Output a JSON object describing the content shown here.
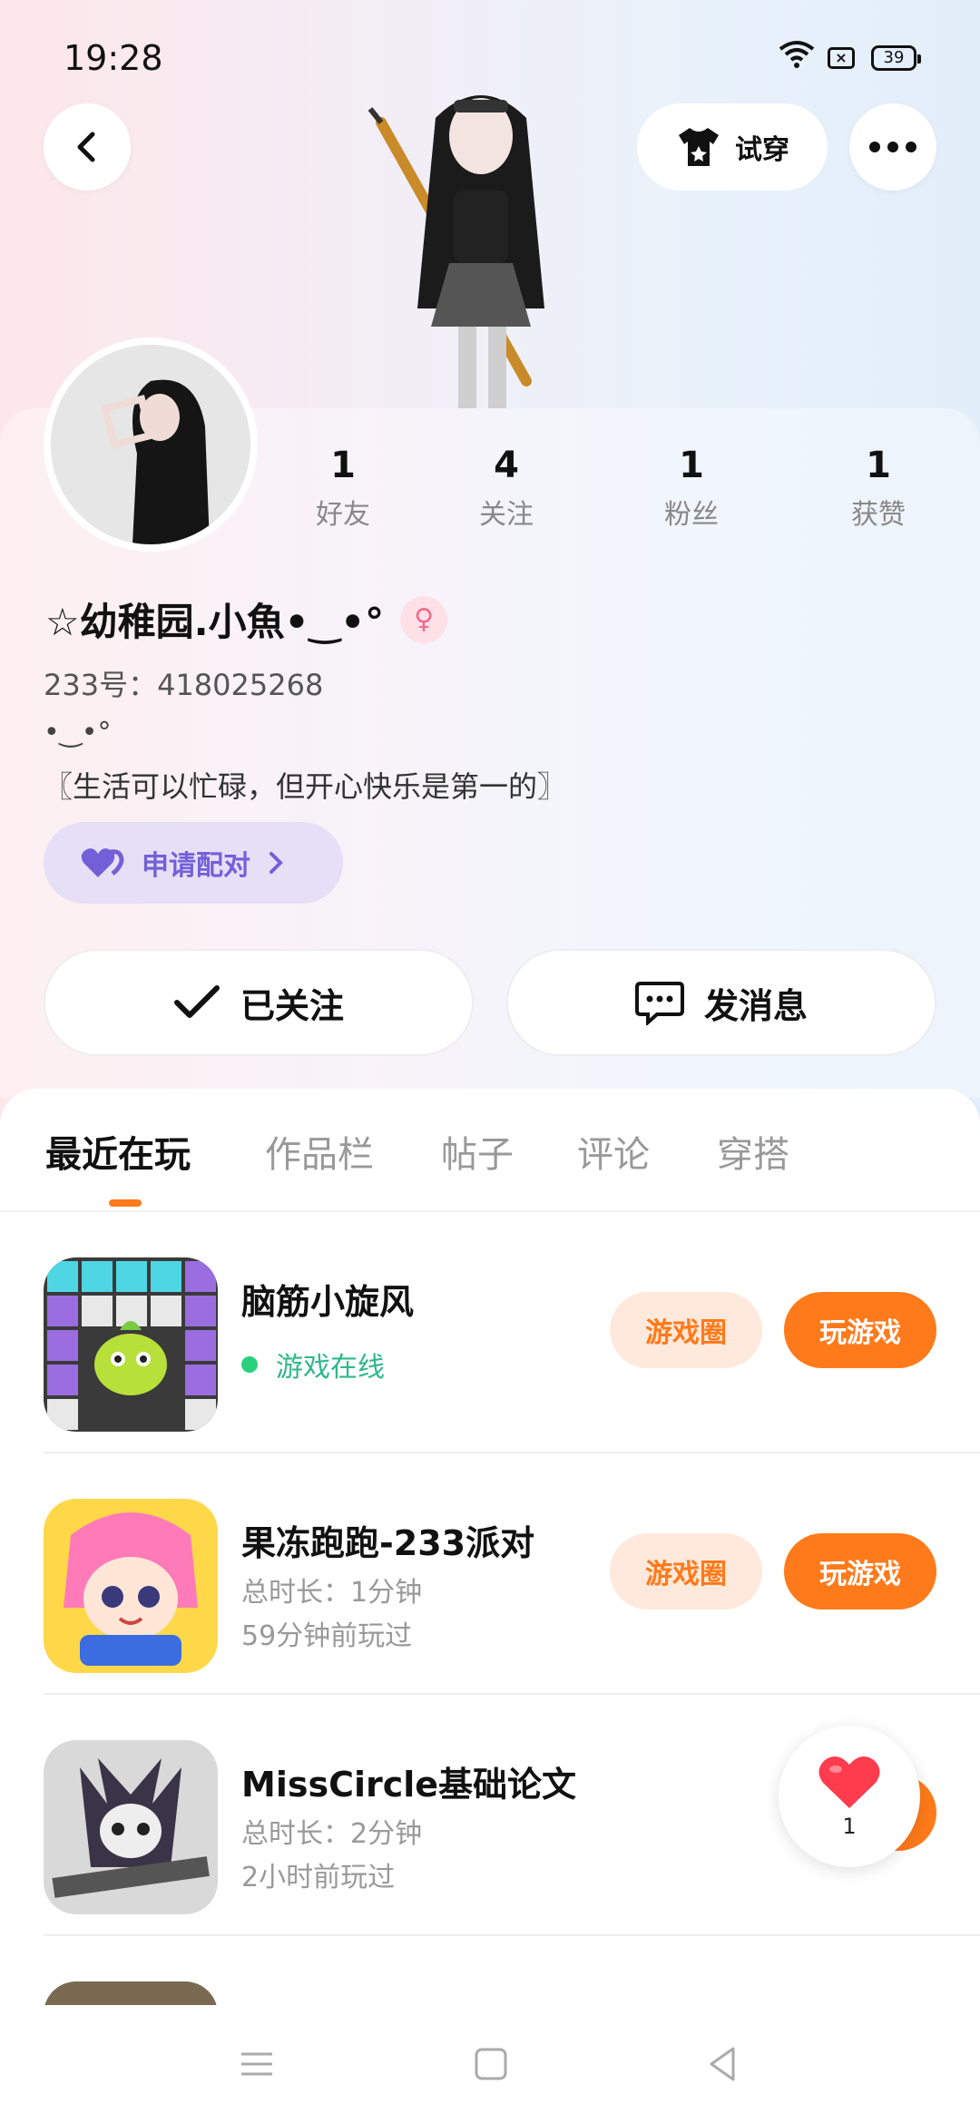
{
  "status_bar": {
    "time": "19:28",
    "battery": "39"
  },
  "header": {
    "tryon_label": "试穿"
  },
  "profile": {
    "stats": [
      {
        "count": "1",
        "label": "好友"
      },
      {
        "count": "4",
        "label": "关注"
      },
      {
        "count": "1",
        "label": "粉丝"
      },
      {
        "count": "1",
        "label": "获赞"
      }
    ],
    "nickname": "☆幼稚园.小魚•‿•°",
    "uid": "233号：418025268",
    "signature_line1": "•‿•°",
    "signature_line2": "〖生活可以忙碌，但开心快乐是第一的〗",
    "pair_label": "申请配对"
  },
  "actions": {
    "follow_label": "已关注",
    "message_label": "发消息"
  },
  "tabs": [
    "最近在玩",
    "作品栏",
    "帖子",
    "评论",
    "穿搭"
  ],
  "games": [
    {
      "title": "脑筋小旋风",
      "online": "游戏在线",
      "circle": "游戏圈",
      "play": "玩游戏"
    },
    {
      "title": "果冻跑跑-233派对",
      "duration": "总时长：1分钟",
      "last": "59分钟前玩过",
      "circle": "游戏圈",
      "play": "玩游戏"
    },
    {
      "title": "MissCircle基础论文",
      "duration": "总时长：2分钟",
      "last": "2小时前玩过"
    }
  ],
  "like_float": {
    "count": "1"
  },
  "colors": {
    "accent": "#ff7a1a",
    "accent_light": "#ffe9dc",
    "pair_purple": "#7360d8",
    "online_green": "#2fb88a"
  }
}
